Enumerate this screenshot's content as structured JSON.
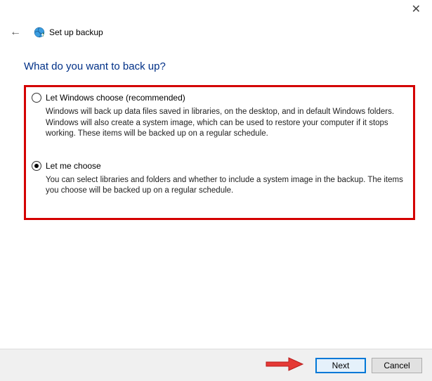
{
  "window": {
    "title": "Set up backup"
  },
  "heading": "What do you want to back up?",
  "options": [
    {
      "label": "Let Windows choose (recommended)",
      "desc": "Windows will back up data files saved in libraries, on the desktop, and in default Windows folders. Windows will also create a system image, which can be used to restore your computer if it stops working. These items will be backed up on a regular schedule.",
      "selected": false
    },
    {
      "label": "Let me choose",
      "desc": "You can select libraries and folders and whether to include a system image in the backup. The items you choose will be backed up on a regular schedule.",
      "selected": true
    }
  ],
  "buttons": {
    "next": "Next",
    "cancel": "Cancel"
  }
}
